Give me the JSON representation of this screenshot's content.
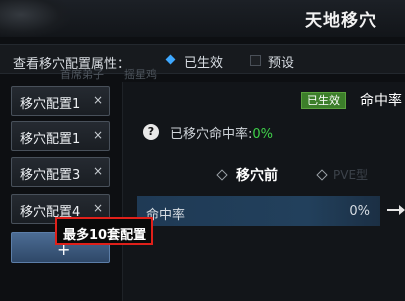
{
  "window": {
    "title": "天地移穴"
  },
  "attr": {
    "label": "查看移穴配置属性：",
    "option_active": "已生效",
    "option_preset": "预设"
  },
  "ghost_text": [
    "首席弟子",
    "摇星鸡"
  ],
  "slots": [
    {
      "label": "移穴配置1",
      "close": "×"
    },
    {
      "label": "移穴配置1",
      "close": "×"
    },
    {
      "label": "移穴配置3",
      "close": "×"
    },
    {
      "label": "移穴配置4",
      "close": "×"
    }
  ],
  "add_button": {
    "label": "+"
  },
  "panel": {
    "badge": "已生效",
    "hit_header": "命中率",
    "help_icon": "?",
    "moved_label": "已移穴命中率:",
    "moved_value": "0%",
    "section_title": "移穴前",
    "pve_ghost": "PVE型",
    "row": {
      "label": "命中率",
      "value": "0%"
    }
  },
  "tooltip": {
    "text": "最多10套配置"
  },
  "colors": {
    "accent_blue": "#3ea8ff",
    "badge_green": "#3c7e2a",
    "value_green": "#3fd14a",
    "tooltip_border": "#e0201a"
  }
}
